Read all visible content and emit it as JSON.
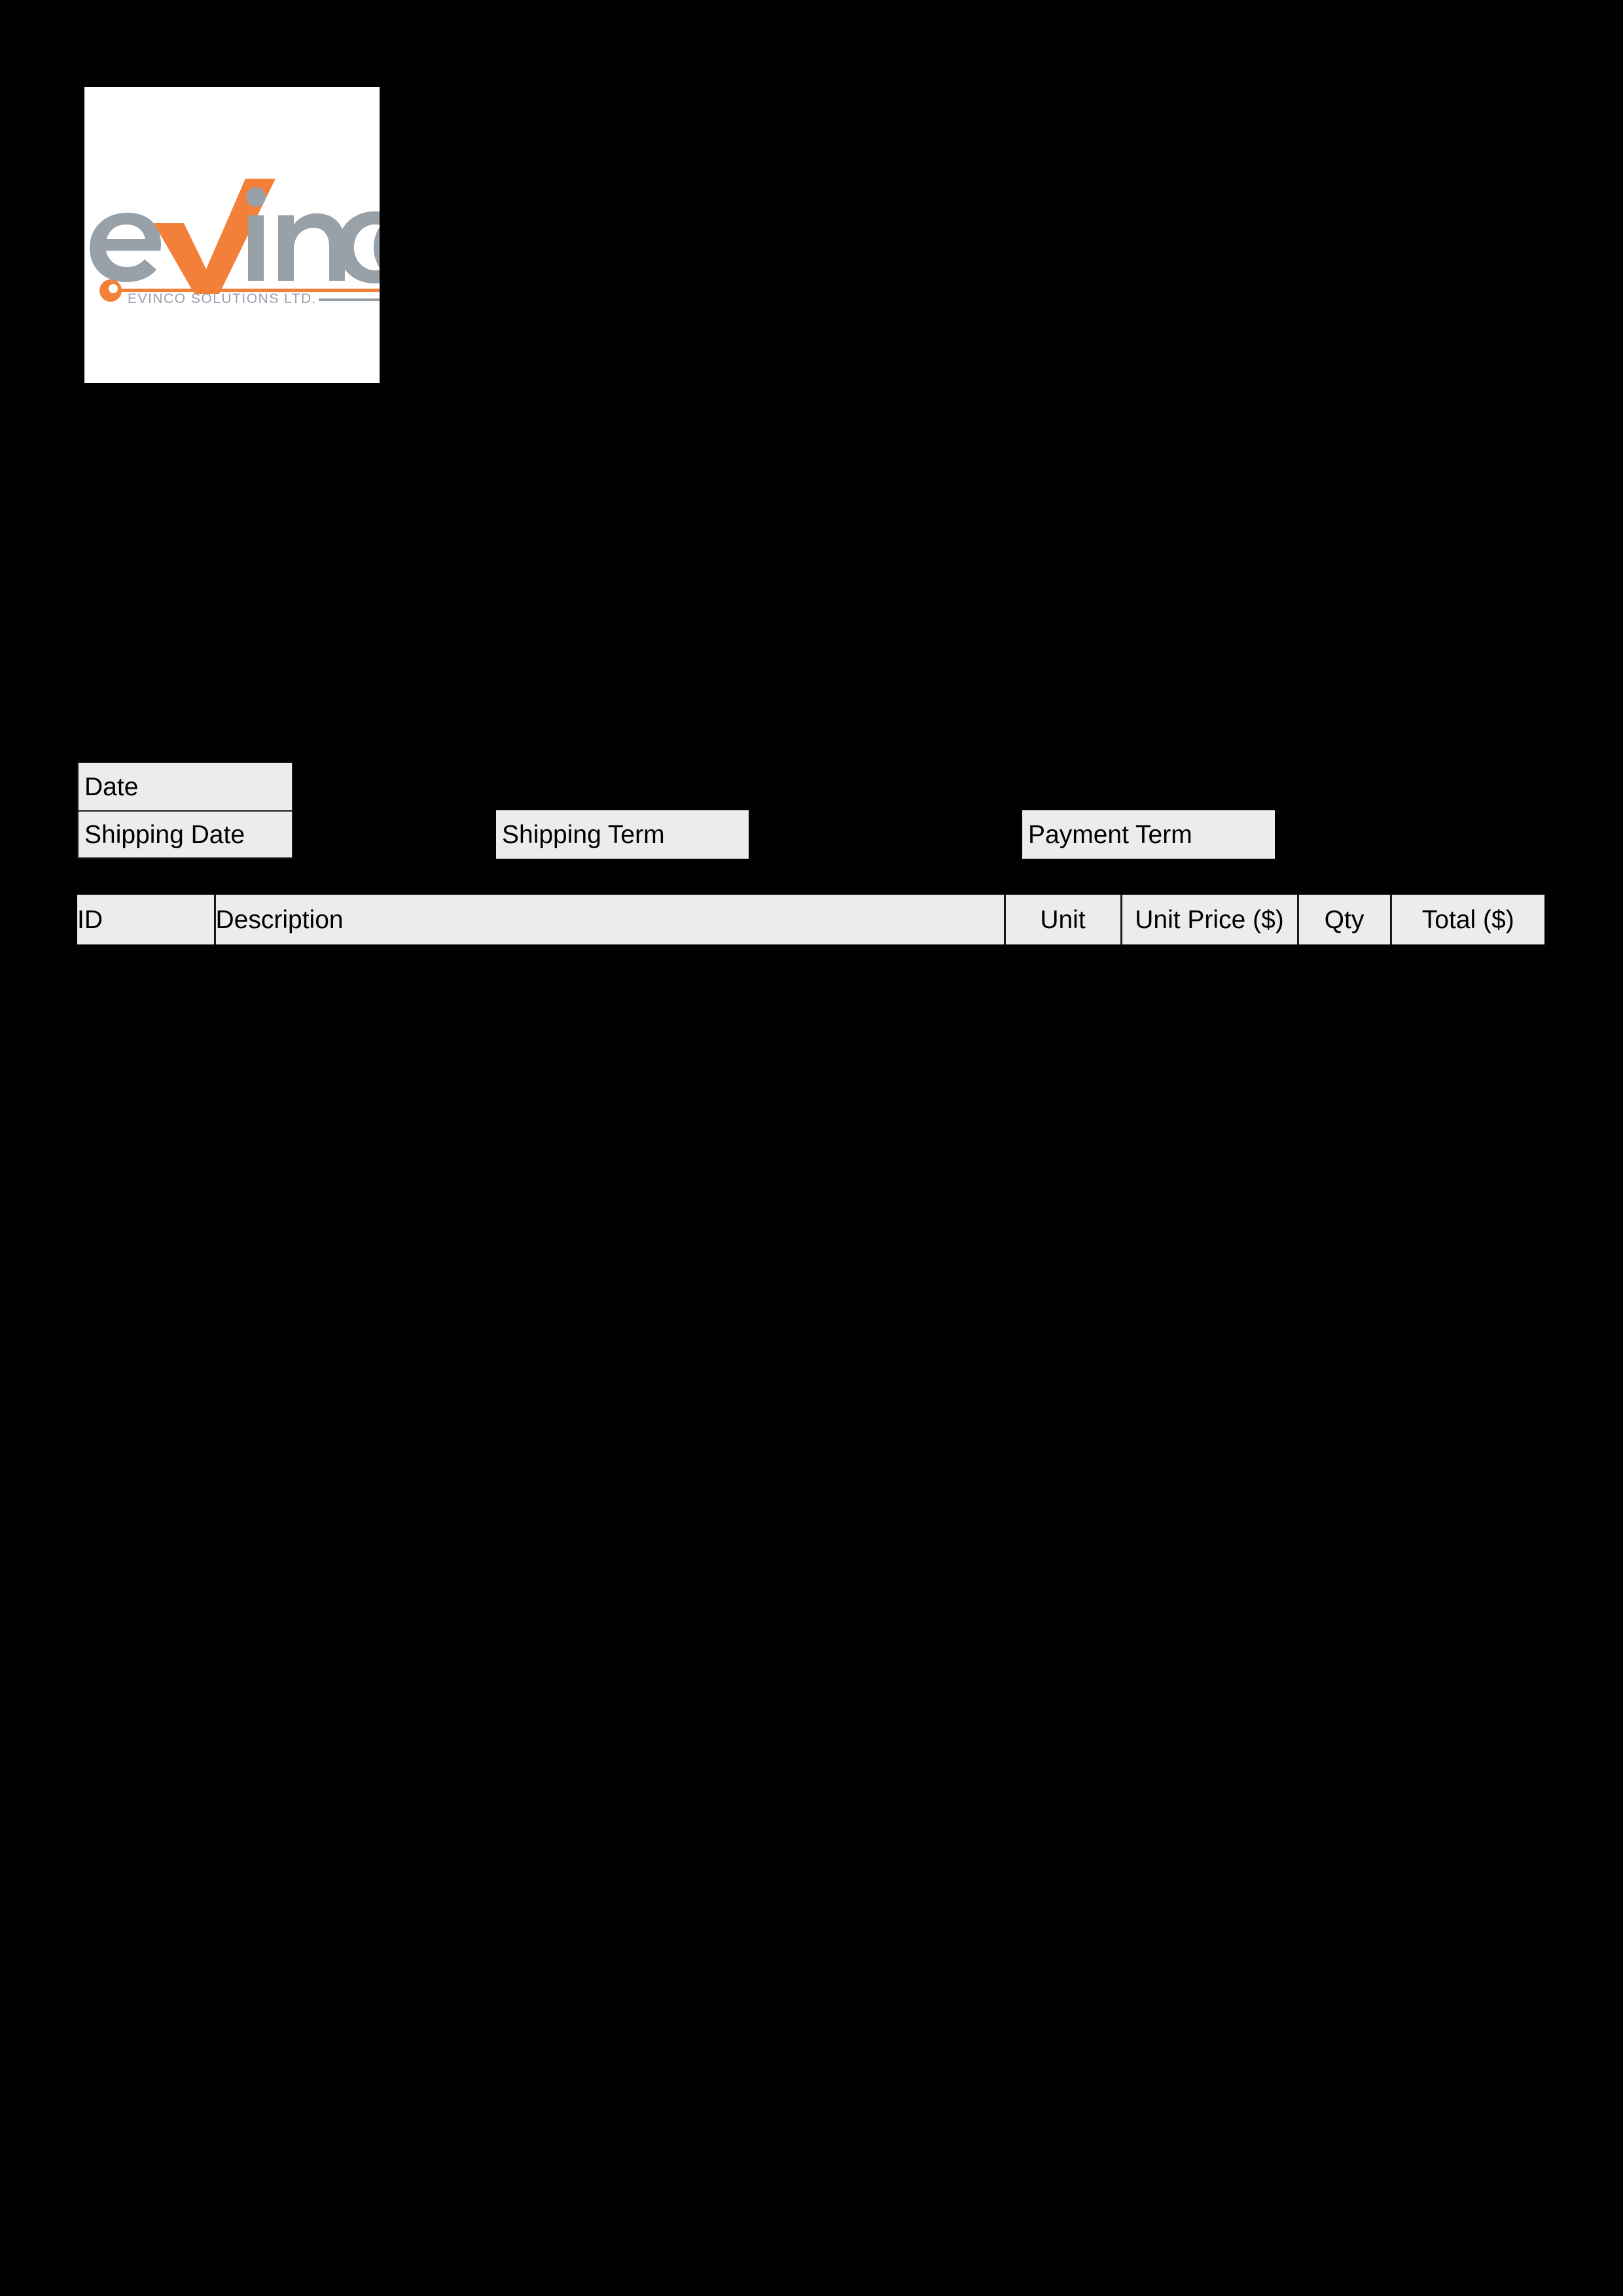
{
  "document": {
    "type": "invoice-template",
    "background_color": "#000000",
    "field_fill_color": "#ececec",
    "text_color": "#000000"
  },
  "logo": {
    "brand_name": "eVinco",
    "brand_prefix": "e",
    "brand_accent_letter": "V",
    "brand_suffix": "inco",
    "tagline": "EVINCO SOLUTIONS LTD.",
    "accent_color": "#f28038",
    "text_color": "#98a0a8",
    "background_color": "#ffffff"
  },
  "fields": {
    "date": {
      "label": "Date",
      "value": ""
    },
    "shipping_date": {
      "label": "Shipping Date",
      "value": ""
    },
    "shipping_term": {
      "label": "Shipping Term",
      "value": ""
    },
    "payment_term": {
      "label": "Payment Term",
      "value": ""
    }
  },
  "items_table": {
    "columns": [
      {
        "key": "id",
        "label": "ID",
        "align": "left"
      },
      {
        "key": "desc",
        "label": "Description",
        "align": "left"
      },
      {
        "key": "unit",
        "label": "Unit",
        "align": "center"
      },
      {
        "key": "price",
        "label": "Unit Price ($)",
        "align": "center"
      },
      {
        "key": "qty",
        "label": "Qty",
        "align": "center"
      },
      {
        "key": "total",
        "label": "Total ($)",
        "align": "center"
      }
    ],
    "rows": []
  }
}
